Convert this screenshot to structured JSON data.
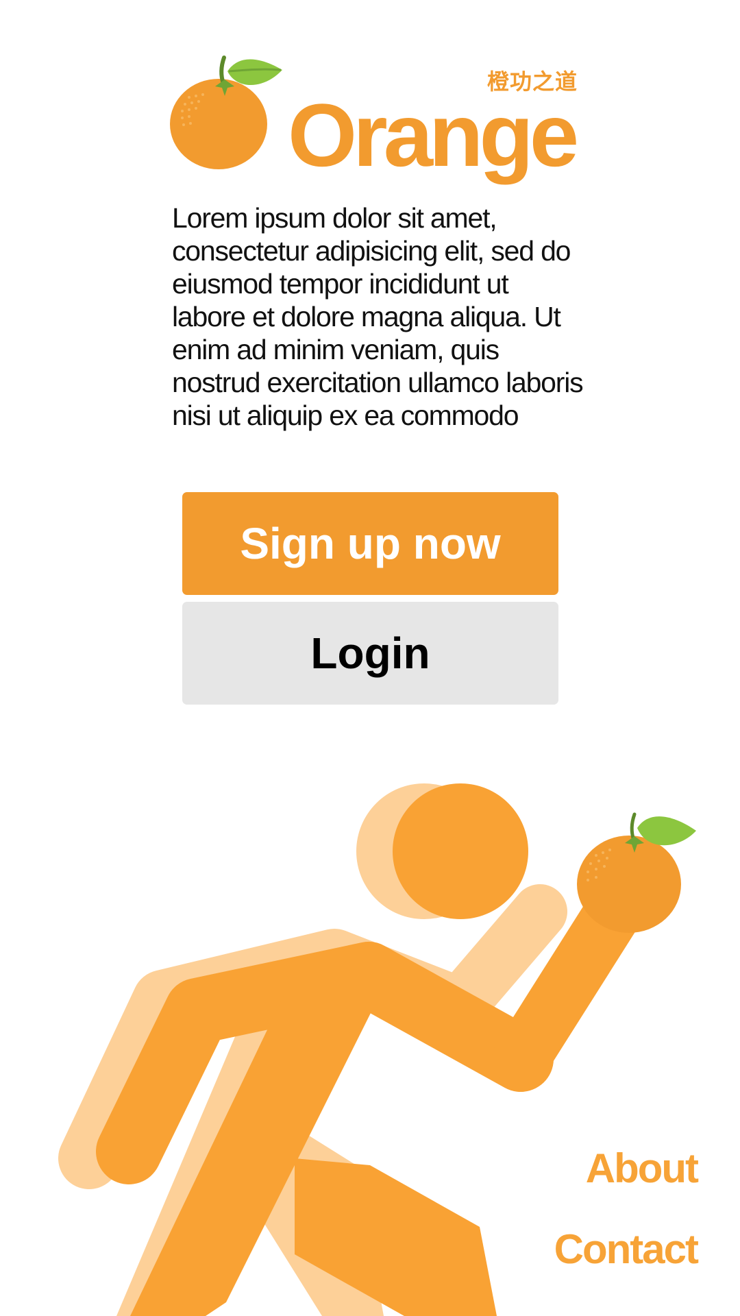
{
  "brand": {
    "name": "Orange",
    "tagline": "橙功之道",
    "logo_icon": "orange-fruit-icon"
  },
  "intro": {
    "text": "Lorem ipsum dolor sit amet, consectetur adipisicing elit, sed do eiusmod tempor incididunt ut labore et dolore magna aliqua. Ut enim ad minim veniam, quis nostrud exercitation ullamco laboris nisi ut aliquip ex ea commodo"
  },
  "actions": {
    "signup_label": "Sign up now",
    "login_label": "Login"
  },
  "hero": {
    "illustration": "running-person-holding-orange"
  },
  "nav": {
    "about": "About",
    "contact": "Contact"
  },
  "colors": {
    "brand_orange": "#f29b2f",
    "figure_orange": "#f9a234",
    "figure_shadow": "#fdd098",
    "leaf_green": "#8cc63f",
    "button_gray": "#e6e6e6"
  }
}
